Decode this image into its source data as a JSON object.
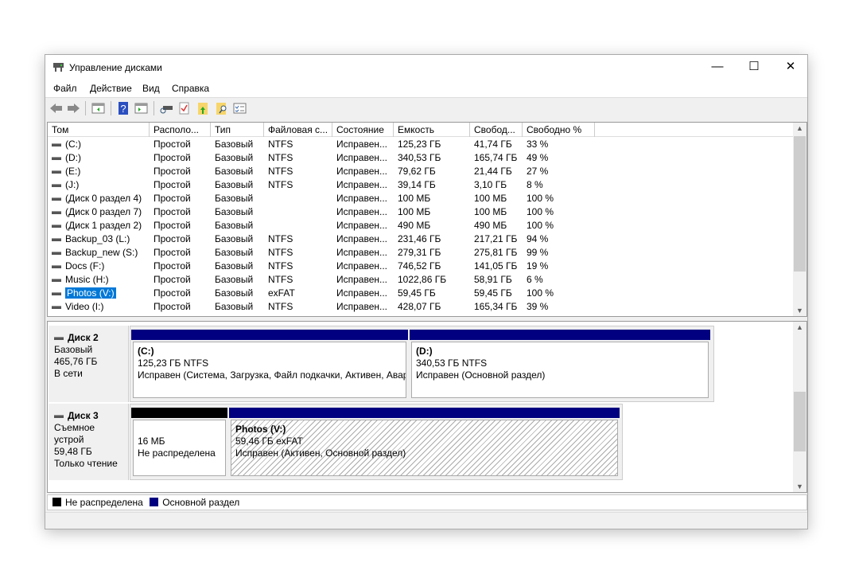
{
  "window": {
    "title": "Управление дисками",
    "minimize": "—",
    "maximize": "☐",
    "close": "✕"
  },
  "menu": [
    "Файл",
    "Действие",
    "Вид",
    "Справка"
  ],
  "toolbar": [
    "back-icon",
    "forward-icon",
    "console-tree-icon",
    "help-icon",
    "action-pane-icon",
    "connect-disk-icon",
    "check-icon",
    "folder-up-icon",
    "folder-search-icon",
    "properties-icon"
  ],
  "columns": [
    "Том",
    "Располо...",
    "Тип",
    "Файловая с...",
    "Состояние",
    "Емкость",
    "Свобод...",
    "Свободно %"
  ],
  "volumes": [
    [
      "(C:)",
      "Простой",
      "Базовый",
      "NTFS",
      "Исправен...",
      "125,23 ГБ",
      "41,74 ГБ",
      "33 %"
    ],
    [
      "(D:)",
      "Простой",
      "Базовый",
      "NTFS",
      "Исправен...",
      "340,53 ГБ",
      "165,74 ГБ",
      "49 %"
    ],
    [
      "(E:)",
      "Простой",
      "Базовый",
      "NTFS",
      "Исправен...",
      "79,62 ГБ",
      "21,44 ГБ",
      "27 %"
    ],
    [
      "(J:)",
      "Простой",
      "Базовый",
      "NTFS",
      "Исправен...",
      "39,14 ГБ",
      "3,10 ГБ",
      "8 %"
    ],
    [
      "(Диск 0 раздел 4)",
      "Простой",
      "Базовый",
      "",
      "Исправен...",
      "100 МБ",
      "100 МБ",
      "100 %"
    ],
    [
      "(Диск 0 раздел 7)",
      "Простой",
      "Базовый",
      "",
      "Исправен...",
      "100 МБ",
      "100 МБ",
      "100 %"
    ],
    [
      "(Диск 1 раздел 2)",
      "Простой",
      "Базовый",
      "",
      "Исправен...",
      "490 МБ",
      "490 МБ",
      "100 %"
    ],
    [
      "Backup_03 (L:)",
      "Простой",
      "Базовый",
      "NTFS",
      "Исправен...",
      "231,46 ГБ",
      "217,21 ГБ",
      "94 %"
    ],
    [
      "Backup_new (S:)",
      "Простой",
      "Базовый",
      "NTFS",
      "Исправен...",
      "279,31 ГБ",
      "275,81 ГБ",
      "99 %"
    ],
    [
      "Docs (F:)",
      "Простой",
      "Базовый",
      "NTFS",
      "Исправен...",
      "746,52 ГБ",
      "141,05 ГБ",
      "19 %"
    ],
    [
      "Music (H:)",
      "Простой",
      "Базовый",
      "NTFS",
      "Исправен...",
      "1022,86 ГБ",
      "58,91 ГБ",
      "6 %"
    ],
    [
      "Photos (V:)",
      "Простой",
      "Базовый",
      "exFAT",
      "Исправен...",
      "59,45 ГБ",
      "59,45 ГБ",
      "100 %"
    ],
    [
      "Video (I:)",
      "Простой",
      "Базовый",
      "NTFS",
      "Исправен...",
      "428,07 ГБ",
      "165,34 ГБ",
      "39 %"
    ]
  ],
  "selected_volume": "Photos (V:)",
  "disks": [
    {
      "name": "Диск 2",
      "type": "Базовый",
      "size": "465,76 ГБ",
      "state": "В сети",
      "partitions": [
        {
          "title": "(C:)",
          "size": "125,23 ГБ NTFS",
          "status": "Исправен (Система, Загрузка, Файл подкачки, Активен, Авар"
        },
        {
          "title": "(D:)",
          "size": "340,53 ГБ NTFS",
          "status": "Исправен (Основной раздел)"
        }
      ]
    },
    {
      "name": "Диск 3",
      "type": "Съемное устрой",
      "size": "59,48 ГБ",
      "state": "Только чтение",
      "partitions": [
        {
          "title": "",
          "size": "16 МБ",
          "status": "Не распределена"
        },
        {
          "title": "Photos  (V:)",
          "size": "59,46 ГБ exFAT",
          "status": "Исправен (Активен, Основной раздел)"
        }
      ]
    }
  ],
  "legend": [
    {
      "label": "Не распределена",
      "color": "#000000"
    },
    {
      "label": "Основной раздел",
      "color": "#000080"
    }
  ]
}
